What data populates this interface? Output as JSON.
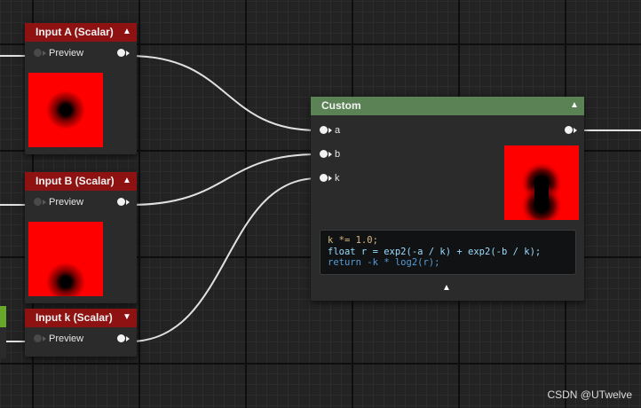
{
  "nodes": {
    "input_a": {
      "title": "Input A (Scalar)",
      "port_label": "Preview",
      "collapse_glyph": "▲"
    },
    "input_b": {
      "title": "Input B (Scalar)",
      "port_label": "Preview",
      "collapse_glyph": "▲"
    },
    "input_k": {
      "title": "Input k (Scalar)",
      "port_label": "Preview",
      "collapse_glyph": "▼"
    },
    "custom": {
      "title": "Custom",
      "collapse_glyph": "▲",
      "inputs": [
        "a",
        "b",
        "k"
      ],
      "code_lines": [
        "k *= 1.0;",
        "float r = exp2(-a / k) + exp2(-b / k);",
        "return -k * log2(r);"
      ],
      "expand_glyph": "▲"
    }
  },
  "colors": {
    "input_header": "#8e1212",
    "custom_header": "#5a8255",
    "preview_red": "#ff0000",
    "wire": "#e0e0e0"
  },
  "watermark": "CSDN @UTwelve"
}
